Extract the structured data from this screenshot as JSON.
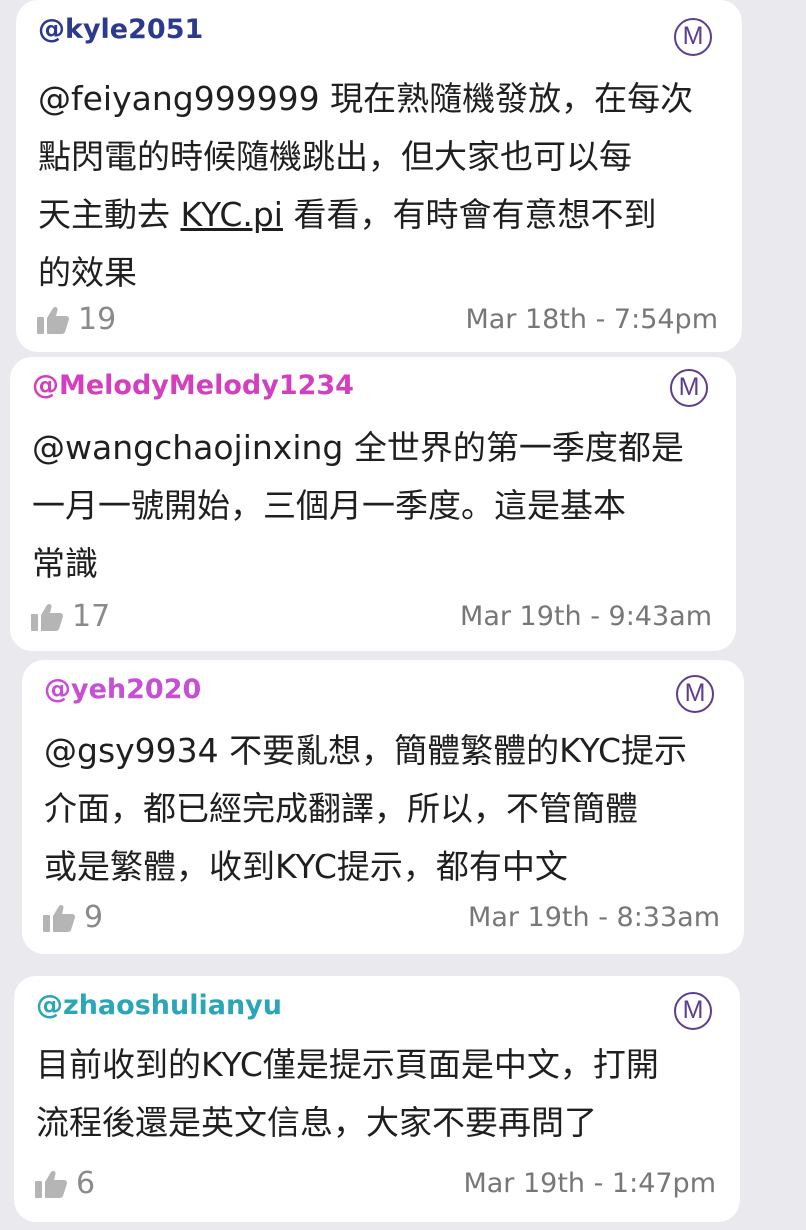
{
  "comments": [
    {
      "username": "@kyle2051",
      "username_color": "#2b3a8f",
      "badge": "M",
      "body_lines": [
        "@feiyang999999 現在熟隨機發放，在每次",
        "點閃電的時候隨機跳出，但大家也可以每"
      ],
      "line3_before": "天主動去 ",
      "line3_link": "KYC.pi",
      "line3_after": " 看看，有時會有意想不到",
      "line4": "的效果",
      "likes": "19",
      "timestamp": "Mar 18th - 7:54pm"
    },
    {
      "username": "@MelodyMelody1234",
      "username_color": "#d33fbf",
      "badge": "M",
      "body_lines": [
        "@wangchaojinxing 全世界的第一季度都是",
        "一月一號開始，三個月一季度。這是基本",
        "常識"
      ],
      "likes": "17",
      "timestamp": "Mar 19th - 9:43am"
    },
    {
      "username": "@yeh2020",
      "username_color": "#c64fd3",
      "badge": "M",
      "body_lines": [
        "@gsy9934 不要亂想，簡體繁體的KYC提示",
        "介面，都已經完成翻譯，所以，不管簡體",
        "或是繁體，收到KYC提示，都有中文"
      ],
      "likes": "9",
      "timestamp": "Mar 19th - 8:33am"
    },
    {
      "username": "@zhaoshulianyu",
      "username_color": "#2aa6b8",
      "badge": "M",
      "body_lines": [
        "目前收到的KYC僅是提示頁面是中文，打開",
        "流程後還是英文信息，大家不要再問了"
      ],
      "likes": "6",
      "timestamp": "Mar 19th - 1:47pm"
    }
  ],
  "icons": {
    "like": "thumbs-up-icon",
    "badge": "moderator-badge-icon"
  }
}
